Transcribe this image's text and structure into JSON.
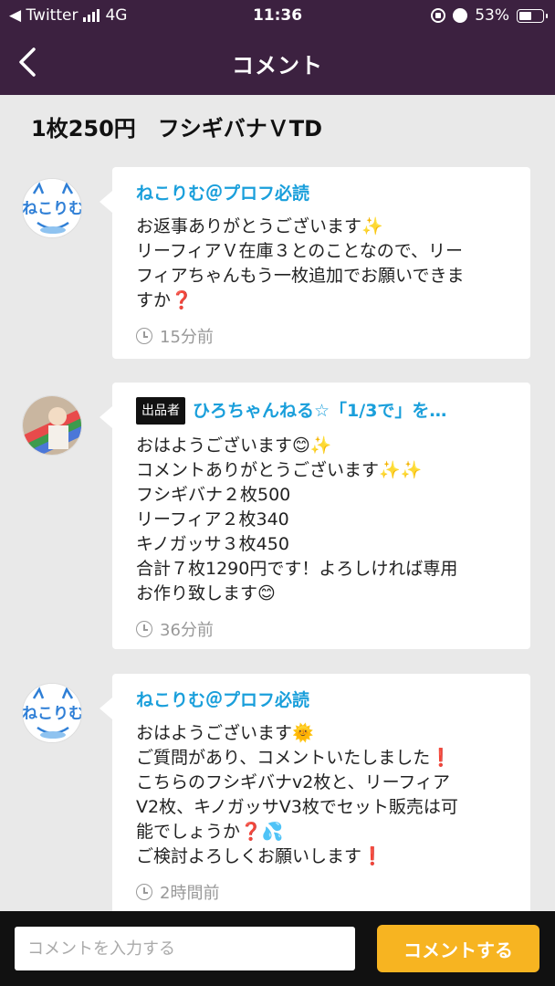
{
  "status_bar": {
    "carrier": "◀ Twitter",
    "network": "4G",
    "time": "11:36",
    "battery": "53%",
    "battery_level": 0.53
  },
  "nav": {
    "title": "コメント",
    "back_icon": "chevron-left-icon"
  },
  "product": {
    "title": "1枚250円　フシギバナＶTD"
  },
  "comments": [
    {
      "author": "ねこりむ＠プロフ必読",
      "is_seller": false,
      "lines": [
        "お返事ありがとうございます✨",
        "リーフィアＶ在庫３とのことなので、リー",
        "フィアちゃんもう一枚追加でお願いできま",
        "すか❓"
      ],
      "time": "15分前"
    },
    {
      "author": "ひろちゃんねる☆「1/3で」を…",
      "is_seller": true,
      "badge": "出品者",
      "lines": [
        "おはようございます😊✨",
        "コメントありがとうございます✨✨",
        "フシギバナ２枚500",
        "リーフィア２枚340",
        "キノガッサ３枚450",
        "合計７枚1290円です！よろしければ専用",
        "お作り致します😊"
      ],
      "time": "36分前"
    },
    {
      "author": "ねこりむ＠プロフ必読",
      "is_seller": false,
      "lines": [
        "おはようございます🌞",
        "ご質問があり、コメントいたしました❗",
        "こちらのフシギバナv2枚と、リーフィア",
        "V2枚、キノガッサV3枚でセット販売は可",
        "能でしょうか❓💦",
        "ご検討よろしくお願いします❗"
      ],
      "time": "2時間前"
    }
  ],
  "footer": {
    "input_placeholder": "コメントを入力する",
    "submit_label": "コメントする"
  },
  "colors": {
    "header_bg": "#3c2140",
    "author": "#1a9fdb",
    "button": "#f7b421"
  }
}
